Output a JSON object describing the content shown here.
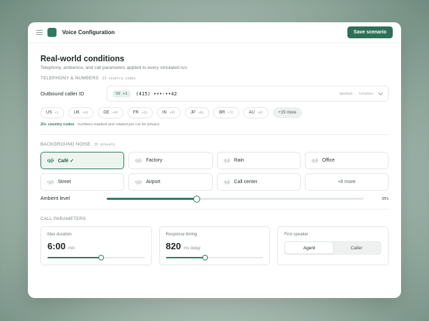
{
  "app": {
    "title": "Voice Configuration",
    "save_label": "Save scenario"
  },
  "page": {
    "title": "Real-world conditions",
    "subtitle": "Telephony, ambience, and call parameters applied to every simulated run"
  },
  "telephony": {
    "label": "TELEPHONY & NUMBERS",
    "count": "23 country codes",
    "caller_label": "Outbound caller ID",
    "caller_country": "US +1",
    "caller_number": "(415) •••-••42",
    "caller_note": "masked · rotates",
    "countries": [
      {
        "code": "US",
        "dial": "+1"
      },
      {
        "code": "UK",
        "dial": "+44"
      },
      {
        "code": "DE",
        "dial": "+49"
      },
      {
        "code": "FR",
        "dial": "+33"
      },
      {
        "code": "IN",
        "dial": "+91"
      },
      {
        "code": "JP",
        "dial": "+81"
      },
      {
        "code": "BR",
        "dial": "+55"
      },
      {
        "code": "AU",
        "dial": "+61"
      }
    ],
    "more_label": "+15 more",
    "note_strong": "20+ country codes",
    "note_rest": " · numbers masked and rotated per run for privacy"
  },
  "noise": {
    "label": "BACKGROUND NOISE",
    "count": "35 presets",
    "presets": [
      {
        "label": "Café ✓",
        "selected": true
      },
      {
        "label": "Factory",
        "selected": false
      },
      {
        "label": "Rain",
        "selected": false
      },
      {
        "label": "Office",
        "selected": false
      },
      {
        "label": "Street",
        "selected": false
      },
      {
        "label": "Airport",
        "selected": false
      },
      {
        "label": "Call center",
        "selected": false
      }
    ],
    "more_label": "+8 more",
    "level_label": "Ambient level",
    "level_value": "35%",
    "level_fraction": 0.35
  },
  "call": {
    "label": "CALL PARAMETERS",
    "max_duration": {
      "label": "Max duration",
      "value": "6:00",
      "unit": "min",
      "fraction": 0.55
    },
    "response_timing": {
      "label": "Response timing",
      "value": "820",
      "unit": "ms delay",
      "fraction": 0.4
    },
    "first_speaker": {
      "label": "First speaker",
      "options": [
        "Agent",
        "Caller"
      ],
      "selected": "Agent"
    }
  },
  "colors": {
    "accent": "#2f7a5e",
    "button": "#2f6f58"
  }
}
